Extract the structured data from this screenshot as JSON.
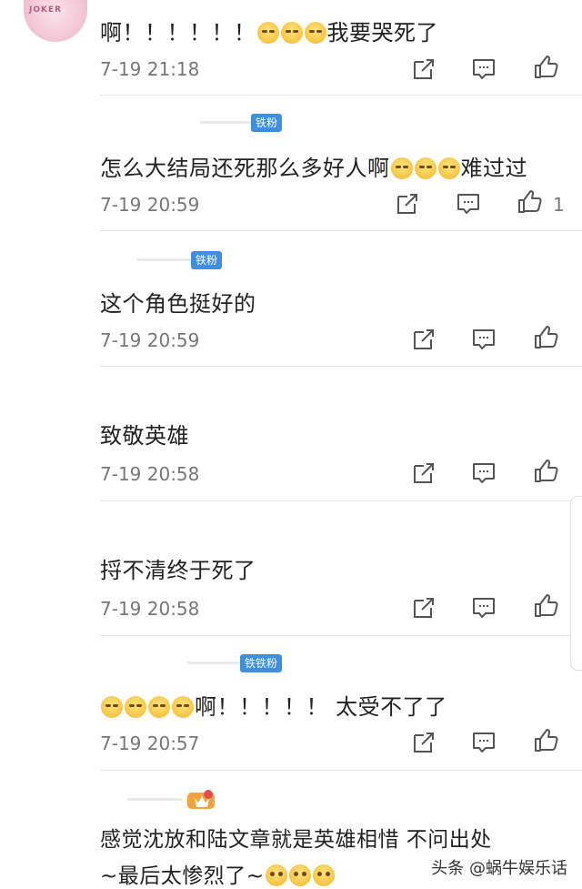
{
  "comments": [
    {
      "text": "啊！！！！！！",
      "emoji_after": "😭😭😭",
      "tail": "我要哭死了",
      "time": "7-19 21:18",
      "likes": ""
    },
    {
      "badge": "铁粉",
      "text": "怎么大结局还死那么多好人啊",
      "tail": "难过过",
      "time": "7-19 20:59",
      "likes": "1"
    },
    {
      "badge": "铁粉",
      "text": "这个角色挺好的",
      "time": "7-19 20:59",
      "likes": ""
    },
    {
      "text": "致敬英雄",
      "time": "7-19 20:58",
      "likes": ""
    },
    {
      "text": "捋不清终于死了",
      "time": "7-19 20:58",
      "likes": ""
    },
    {
      "badge": "铁铁粉",
      "text": "啊！！！！！ 太受不了了",
      "time": "7-19 20:57",
      "likes": ""
    },
    {
      "text": "感觉沈放和陆文章就是英雄相惜 不问出处",
      "text2": "~最后太惨烈了~"
    }
  ],
  "watermark": "头条 @蜗牛娱乐话",
  "icons": {
    "share": "share-icon",
    "comment": "comment-icon",
    "like": "like-icon"
  }
}
